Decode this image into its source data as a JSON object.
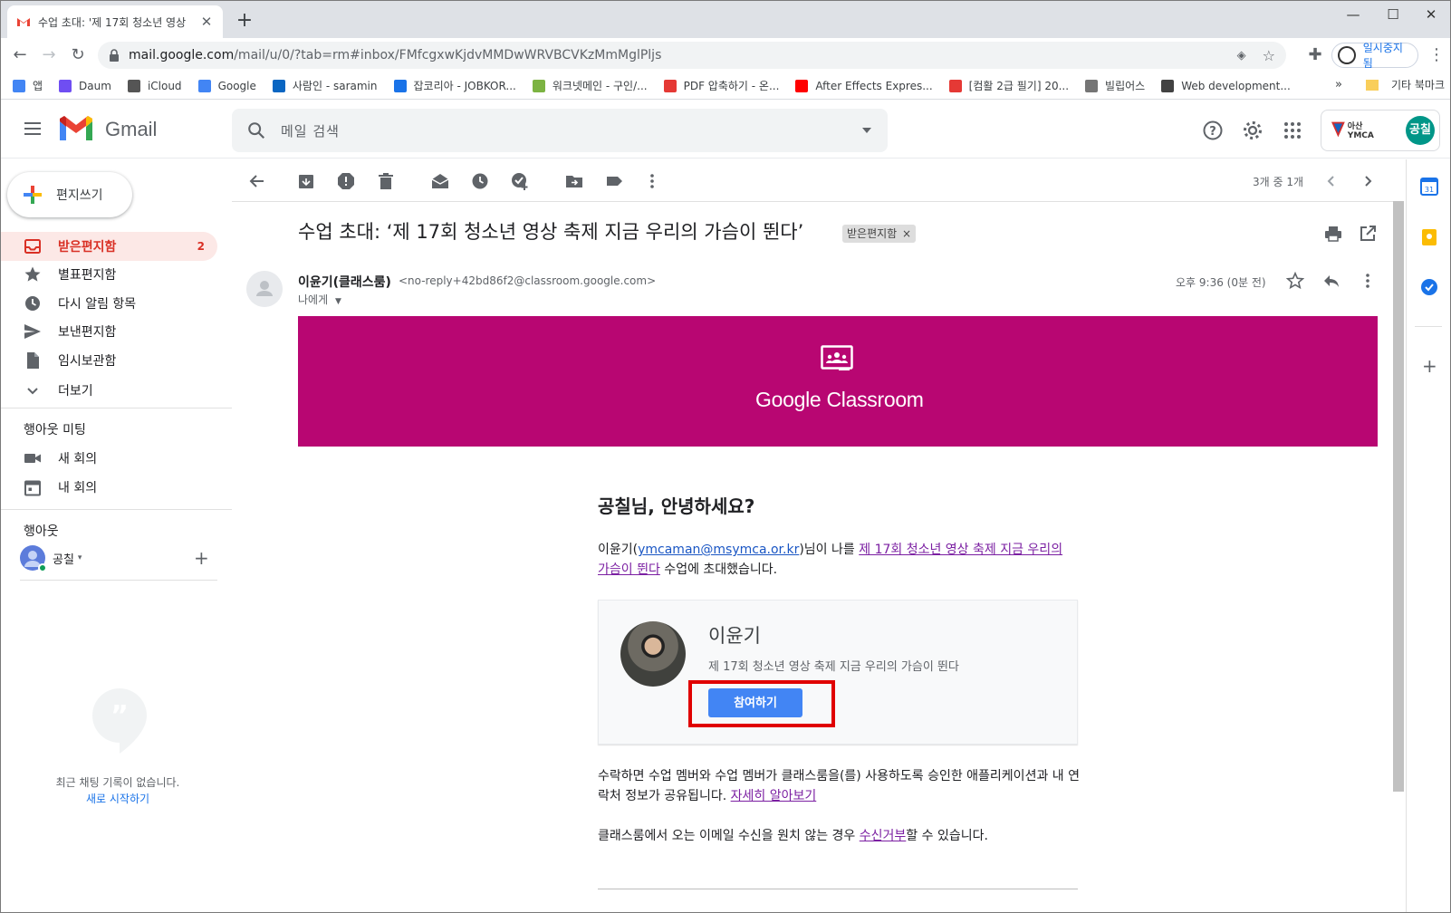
{
  "browser": {
    "tab_title": "수업 초대: '제 17회 청소년 영상",
    "url_host": "mail.google.com",
    "url_path": "/mail/u/0/?tab=rm#inbox/FMfcgxwKjdvMMDwWRVBCVKzMmMglPljs",
    "profile_label": "일시중지됨",
    "bookmarks": [
      {
        "label": "앱",
        "icon": "apps-grid-icon",
        "color": "#4285f4"
      },
      {
        "label": "Daum",
        "icon": "daum-icon",
        "color": "#6f4ef2"
      },
      {
        "label": "iCloud",
        "icon": "apple-icon",
        "color": "#555555"
      },
      {
        "label": "Google",
        "icon": "google-icon",
        "color": "#4285f4"
      },
      {
        "label": "사람인 - saramin",
        "icon": "linkedin-icon",
        "color": "#0a66c2"
      },
      {
        "label": "잡코리아 - JOBKOR...",
        "icon": "chat-bubble-icon",
        "color": "#1a73e8"
      },
      {
        "label": "워크넷메인 - 구인/...",
        "icon": "worknet-icon",
        "color": "#7cb342"
      },
      {
        "label": "PDF 압축하기 - 온...",
        "icon": "pdf-icon",
        "color": "#e53935"
      },
      {
        "label": "After Effects Expres...",
        "icon": "youtube-icon",
        "color": "#ff0000"
      },
      {
        "label": "[컴활 2급 필기] 20...",
        "icon": "umbrella-icon",
        "color": "#e53935"
      },
      {
        "label": "빌립어스",
        "icon": "hand-icon",
        "color": "#757575"
      },
      {
        "label": "Web development...",
        "icon": "globe-icon",
        "color": "#424242"
      }
    ],
    "bookmarks_more": "»",
    "other_bookmarks": "기타 북마크"
  },
  "gmail": {
    "app_name": "Gmail",
    "search_placeholder": "메일 검색",
    "account_initials": "공칠",
    "account_org": "아산YMCA",
    "compose_label": "편지쓰기",
    "nav": [
      {
        "label": "받은편지함",
        "count": "2",
        "icon": "inbox-icon"
      },
      {
        "label": "별표편지함",
        "count": "",
        "icon": "star-icon"
      },
      {
        "label": "다시 알림 항목",
        "count": "",
        "icon": "clock-icon"
      },
      {
        "label": "보낸편지함",
        "count": "",
        "icon": "send-icon"
      },
      {
        "label": "임시보관함",
        "count": "",
        "icon": "draft-icon"
      },
      {
        "label": "더보기",
        "count": "",
        "icon": "chevron-down-icon"
      }
    ],
    "meet_title": "행아웃 미팅",
    "meet_items": [
      {
        "label": "새 회의",
        "icon": "video-icon"
      },
      {
        "label": "내 회의",
        "icon": "calendar-icon"
      }
    ],
    "hangouts_title": "행아웃",
    "hangouts_user": "공칠",
    "chat_empty": "최근 채팅 기록이 없습니다.",
    "chat_start": "새로 시작하기",
    "pager": "3개 중 1개"
  },
  "email": {
    "subject": "수업 초대: ‘제 17회 청소년 영상 축제 지금 우리의 가슴이 뛴다’",
    "label_chip": "받은편지함",
    "sender_name": "이윤기(클래스룸)",
    "sender_address": "<no-reply+42bd86f2@classroom.google.com>",
    "to_line": "나에게",
    "time": "오후 9:36 (0분 전)",
    "banner_title": "Google Classroom",
    "greeting": "공칠님, 안녕하세요?",
    "invite_prefix": "이윤기(",
    "invite_email": "ymcaman@msymca.or.kr",
    "invite_middle": ")님이 나를 ",
    "invite_class_link": "제 17회 청소년 영상 축제 지금 우리의 가슴이 뛴다",
    "invite_suffix": " 수업에 초대했습니다.",
    "teacher_name": "이윤기",
    "class_name": "제 17회 청소년 영상 축제 지금 우리의 가슴이 뛴다",
    "join_button": "참여하기",
    "consent_text": "수락하면 수업 멤버와 수업 멤버가 클래스룸을(를) 사용하도록 승인한 애플리케이션과 내 연락처 정보가 공유됩니다. ",
    "learn_more": "자세히 알아보기",
    "unsub_prefix": "클래스룸에서 오는 이메일 수신을 원치 않는 경우 ",
    "unsub_link": "수신거부",
    "unsub_suffix": "할 수 있습니다."
  },
  "colors": {
    "banner": "#b80672",
    "join_button": "#4285f4",
    "active_nav": "#d93025",
    "highlight": "#e00000"
  }
}
